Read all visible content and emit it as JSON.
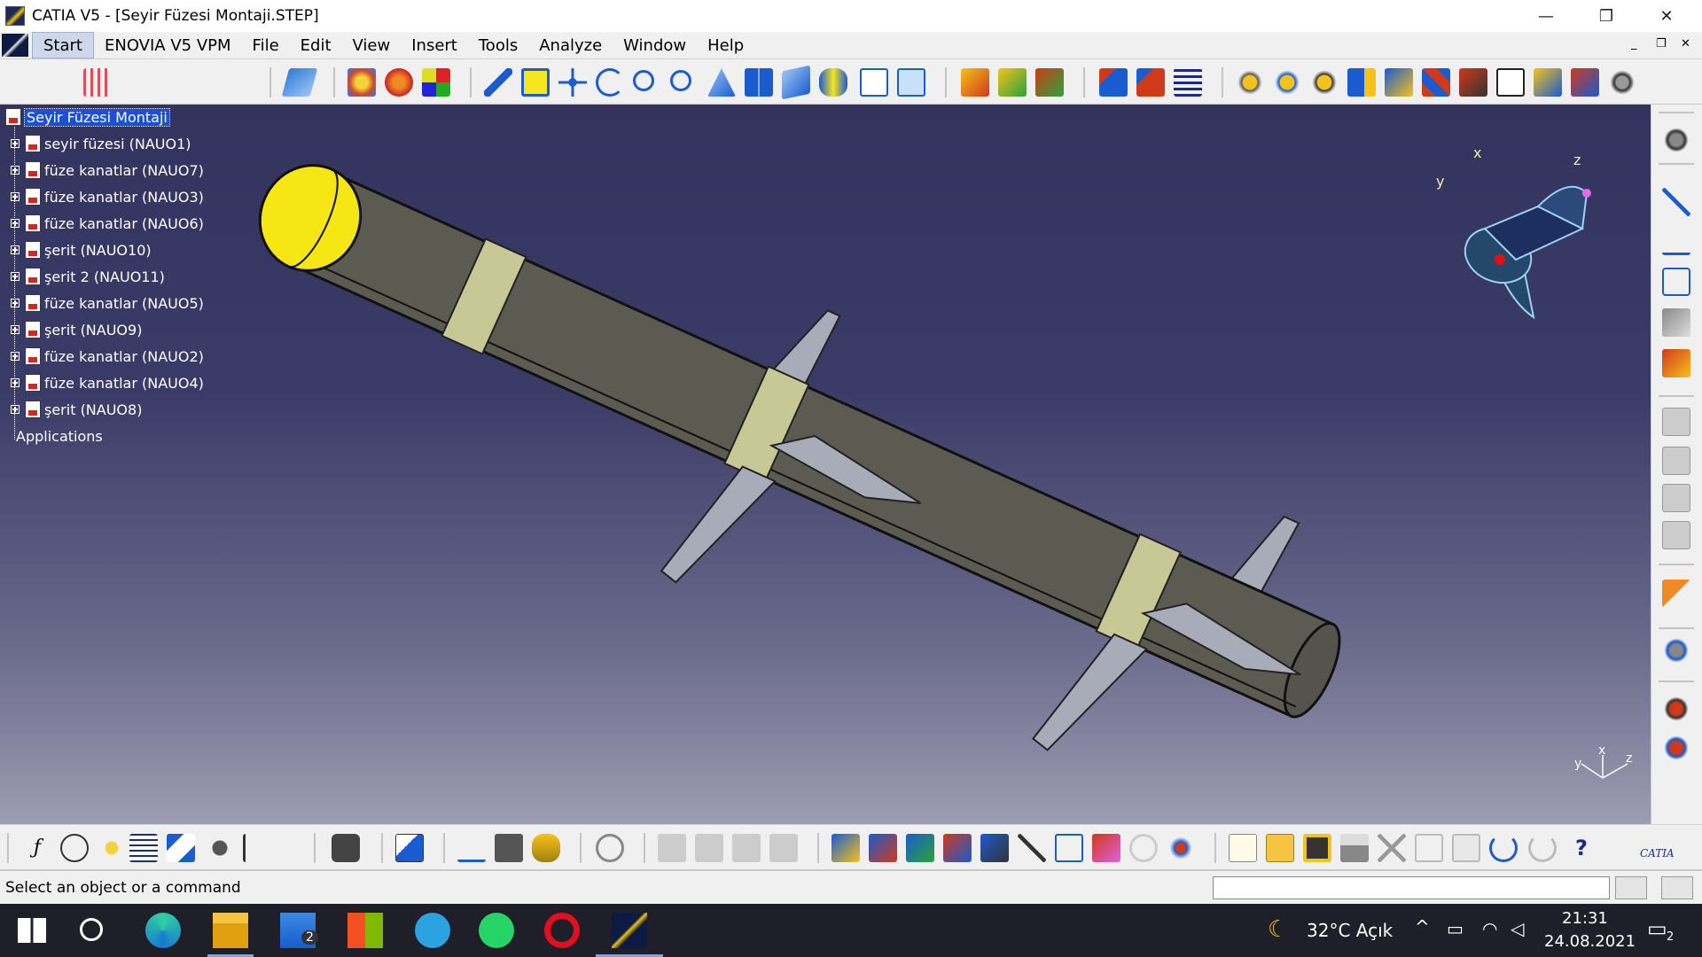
{
  "window": {
    "title": "CATIA V5 - [Seyir Füzesi Montaji.STEP]",
    "controls": {
      "minimize": "—",
      "maximize": "❐",
      "close": "✕"
    }
  },
  "menu": {
    "items": [
      "Start",
      "ENOVIA V5 VPM",
      "File",
      "Edit",
      "View",
      "Insert",
      "Tools",
      "Analyze",
      "Window",
      "Help"
    ],
    "doc_controls": {
      "minimize": "_",
      "restore": "❐",
      "close": "✕"
    }
  },
  "tree": {
    "root": "Seyir Füzesi Montaji",
    "children": [
      "seyir füzesi (NAUO1)",
      "füze kanatlar (NAUO7)",
      "füze kanatlar (NAUO3)",
      "füze kanatlar (NAUO6)",
      "şerit (NAUO10)",
      "şerit 2 (NAUO11)",
      "füze kanatlar (NAUO5)",
      "şerit (NAUO9)",
      "füze kanatlar (NAUO2)",
      "füze kanatlar (NAUO4)",
      "şerit (NAUO8)"
    ],
    "applications": "Applications"
  },
  "compass": {
    "x": "x",
    "y": "y",
    "z": "z"
  },
  "axis_triad": {
    "x": "x",
    "y": "y",
    "z": "z"
  },
  "toolbar_icons": {
    "top": [
      "plane-icon",
      "part-body-icon",
      "sketch-icon",
      "color-icon",
      "fly-mode-icon",
      "fit-all-icon",
      "pan-icon",
      "rotate-icon",
      "zoom-in-icon",
      "zoom-out-icon",
      "normal-view-icon",
      "multi-view-icon",
      "iso-view-icon",
      "render-style-icon",
      "hide-show-icon",
      "swap-visible-icon",
      "insert-component-icon",
      "insert-product-icon",
      "existing-component-icon",
      "manipulation-icon",
      "snap-icon",
      "explode-icon",
      "update-icon",
      "catalog-icon",
      "text-annotation-icon",
      "constraint-icon",
      "fix-component-icon",
      "analyze-icon",
      "measure-icon"
    ],
    "bottom": [
      "formula-icon",
      "comment-icon",
      "light-icon",
      "table-icon",
      "spec-tree-icon",
      "lock-icon",
      "parameter-icon",
      "camera-icon",
      "scene-icon",
      "measure-between-icon",
      "measure-item-icon",
      "inertia-icon",
      "refresh-icon",
      "clash-icon",
      "sectioning-icon",
      "distance-icon",
      "group-icon",
      "publish-icon",
      "bill-of-material-icon",
      "mechanical-icon",
      "new-icon",
      "open-icon",
      "save-icon",
      "print-icon",
      "cut-icon",
      "copy-icon",
      "paste-icon",
      "undo-icon",
      "redo-icon",
      "help-icon"
    ],
    "right": [
      "gear-icon",
      "dimension-icon",
      "text-icon",
      "sketch-tool-icon",
      "material-icon",
      "catalog-browser-icon",
      "component-icon",
      "subassembly-icon",
      "replace-icon",
      "reorder-icon",
      "select-arrow-icon",
      "settings-icon",
      "design-table-icon",
      "knowledge-icon"
    ]
  },
  "status": {
    "message": "Select an object or a command",
    "input_value": ""
  },
  "taskbar": {
    "apps": [
      "windows-start-icon",
      "search-icon",
      "edge-icon",
      "file-explorer-icon",
      "mail-icon",
      "store-icon",
      "telegram-icon",
      "whatsapp-icon",
      "opera-icon",
      "catia-icon"
    ],
    "mail_badge": "2",
    "weather": "32°C Açık",
    "time": "21:31",
    "date": "24.08.2021",
    "notification_count": "2"
  },
  "colors": {
    "viewport_top": "#33335e",
    "viewport_bottom": "#9c9cb2",
    "missile_body": "#5c5b52",
    "missile_nose": "#f5e614",
    "band": "#c8c897",
    "fin": "#a8abb8",
    "selection": "#1a4fd8"
  }
}
